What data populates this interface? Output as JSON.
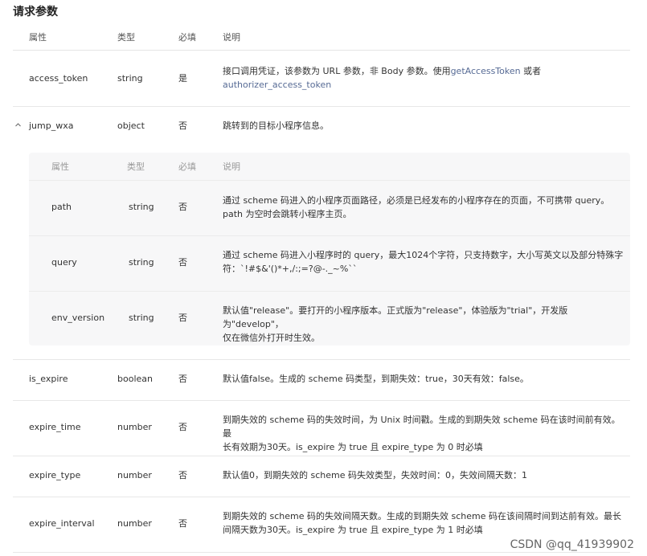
{
  "title": "请求参数",
  "columns": {
    "attr": "属性",
    "type": "类型",
    "required": "必填",
    "desc": "说明"
  },
  "rows": {
    "access_token": {
      "name": "access_token",
      "type": "string",
      "required": "是",
      "desc_a": "接口调用凭证，该参数为 URL 参数，非 Body 参数。使用",
      "link1": "getAccessToken",
      "desc_b": " 或者",
      "link2": "authorizer_access_token"
    },
    "jump_wxa": {
      "name": "jump_wxa",
      "type": "object",
      "required": "否",
      "desc": "跳转到的目标小程序信息。"
    },
    "is_expire": {
      "name": "is_expire",
      "type": "boolean",
      "required": "否",
      "desc": "默认值false。生成的 scheme 码类型，到期失效：true，30天有效：false。"
    },
    "expire_time": {
      "name": "expire_time",
      "type": "number",
      "required": "否",
      "desc_l1": "到期失效的 scheme 码的失效时间，为 Unix 时间戳。生成的到期失效 scheme 码在该时间前有效。最",
      "desc_l2": "长有效期为30天。is_expire 为 true 且 expire_type 为 0 时必填"
    },
    "expire_type": {
      "name": "expire_type",
      "type": "number",
      "required": "否",
      "desc": "默认值0，到期失效的 scheme 码失效类型，失效时间：0，失效间隔天数：1"
    },
    "expire_interval": {
      "name": "expire_interval",
      "type": "number",
      "required": "否",
      "desc_l1": "到期失效的 scheme 码的失效间隔天数。生成的到期失效 scheme 码在该间隔时间到达前有效。最长",
      "desc_l2": "间隔天数为30天。is_expire 为 true 且 expire_type 为 1 时必填"
    }
  },
  "nested": {
    "columns": {
      "attr": "属性",
      "type": "类型",
      "required": "必填",
      "desc": "说明"
    },
    "path": {
      "name": "path",
      "type": "string",
      "required": "否",
      "desc_l1": "通过 scheme 码进入的小程序页面路径，必须是已经发布的小程序存在的页面，不可携带 query。",
      "desc_l2": "path 为空时会跳转小程序主页。"
    },
    "query": {
      "name": "query",
      "type": "string",
      "required": "否",
      "desc_l1": "通过 scheme 码进入小程序时的 query，最大1024个字符，只支持数字，大小写英文以及部分特殊字",
      "desc_l2": "符：`!#$&'()*+,/:;=?@-._~%``"
    },
    "env_version": {
      "name": "env_version",
      "type": "string",
      "required": "否",
      "desc_l1": "默认值\"release\"。要打开的小程序版本。正式版为\"release\"，体验版为\"trial\"，开发版为\"develop\"，",
      "desc_l2": "仅在微信外打开时生效。"
    }
  },
  "watermark": "CSDN @qq_41939902",
  "colors": {
    "link": "#576b95",
    "nested_bg": "#f7f7f8",
    "divider": "#e8e8e8"
  }
}
